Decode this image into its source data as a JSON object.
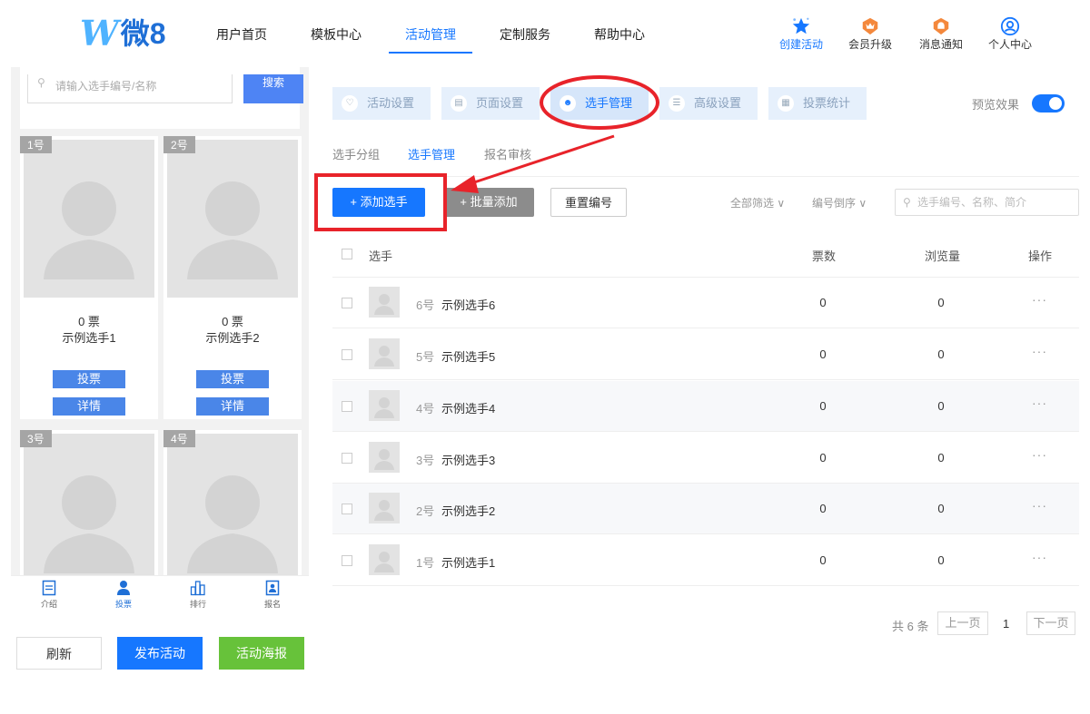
{
  "brand": {
    "logo_w": "W",
    "logo_text": "微8"
  },
  "nav": {
    "items": [
      {
        "label": "用户首页",
        "active": false
      },
      {
        "label": "模板中心",
        "active": false
      },
      {
        "label": "活动管理",
        "active": true
      },
      {
        "label": "定制服务",
        "active": false
      },
      {
        "label": "帮助中心",
        "active": false
      }
    ],
    "utilities": [
      {
        "label": "创建活动",
        "icon": "star-icon"
      },
      {
        "label": "会员升级",
        "icon": "crown-badge-icon"
      },
      {
        "label": "消息通知",
        "icon": "bell-badge-icon"
      },
      {
        "label": "个人中心",
        "icon": "user-circle-icon"
      }
    ]
  },
  "preview": {
    "search_placeholder": "请输入选手编号/名称",
    "search_button": "搜索",
    "cards": [
      {
        "num": "1号",
        "votes": "0 票",
        "name": "示例选手1",
        "vote_label": "投票",
        "detail_label": "详情"
      },
      {
        "num": "2号",
        "votes": "0 票",
        "name": "示例选手2",
        "vote_label": "投票",
        "detail_label": "详情"
      },
      {
        "num": "3号"
      },
      {
        "num": "4号"
      }
    ],
    "tabs": [
      {
        "label": "介绍",
        "icon": "document-icon"
      },
      {
        "label": "投票",
        "icon": "person-icon"
      },
      {
        "label": "排行",
        "icon": "bar-chart-icon"
      },
      {
        "label": "报名",
        "icon": "signup-icon"
      }
    ],
    "actions": {
      "refresh": "刷新",
      "publish": "发布活动",
      "poster": "活动海报"
    }
  },
  "steps": [
    {
      "label": "活动设置",
      "active": false
    },
    {
      "label": "页面设置",
      "active": false
    },
    {
      "label": "选手管理",
      "active": true
    },
    {
      "label": "高级设置",
      "active": false
    },
    {
      "label": "投票统计",
      "active": false
    }
  ],
  "preview_toggle": {
    "label": "预览效果",
    "on": true
  },
  "subtabs": [
    {
      "label": "选手分组",
      "active": false
    },
    {
      "label": "选手管理",
      "active": true
    },
    {
      "label": "报名审核",
      "active": false
    }
  ],
  "toolbar": {
    "add": "+ 添加选手",
    "batch": "+ 批量添加",
    "renumber": "重置编号",
    "filter_all": "全部筛选 ∨",
    "sort": "编号倒序 ∨",
    "search_placeholder": "选手编号、名称、简介"
  },
  "table": {
    "headers": {
      "player": "选手",
      "votes": "票数",
      "views": "浏览量",
      "ops": "操作"
    },
    "rows": [
      {
        "no": "6号",
        "name": "示例选手6",
        "votes": "0",
        "views": "0",
        "ops": "···"
      },
      {
        "no": "5号",
        "name": "示例选手5",
        "votes": "0",
        "views": "0",
        "ops": "···"
      },
      {
        "no": "4号",
        "name": "示例选手4",
        "votes": "0",
        "views": "0",
        "ops": "···"
      },
      {
        "no": "3号",
        "name": "示例选手3",
        "votes": "0",
        "views": "0",
        "ops": "···"
      },
      {
        "no": "2号",
        "name": "示例选手2",
        "votes": "0",
        "views": "0",
        "ops": "···"
      },
      {
        "no": "1号",
        "name": "示例选手1",
        "votes": "0",
        "views": "0",
        "ops": "···"
      }
    ]
  },
  "pagination": {
    "total": "共 6 条",
    "prev": "上一页",
    "current": "1",
    "next": "下一页"
  },
  "colors": {
    "primary": "#1677ff",
    "annotation": "#e8232a",
    "success": "#67c23a"
  }
}
